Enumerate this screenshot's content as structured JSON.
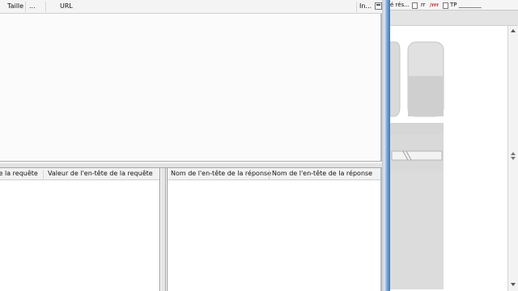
{
  "request_list": {
    "columns": [
      {
        "label": "Taille"
      },
      {
        "label": "..."
      },
      {
        "label": "URL"
      },
      {
        "label": "In..."
      }
    ]
  },
  "request_headers": {
    "columns": [
      {
        "label": "e de la requête"
      },
      {
        "label": "Valeur de l'en-tête de la requête"
      }
    ]
  },
  "response_headers": {
    "columns": [
      {
        "label": "Nom de l'en-tête de la réponse"
      },
      {
        "label": "Nom de l'en-tête de la réponse"
      }
    ]
  },
  "background_browser": {
    "bookmarks": [
      {
        "label": "é rés..."
      },
      {
        "label": "rr"
      },
      {
        "label": "/rrr"
      },
      {
        "label": "TP ________"
      }
    ]
  }
}
